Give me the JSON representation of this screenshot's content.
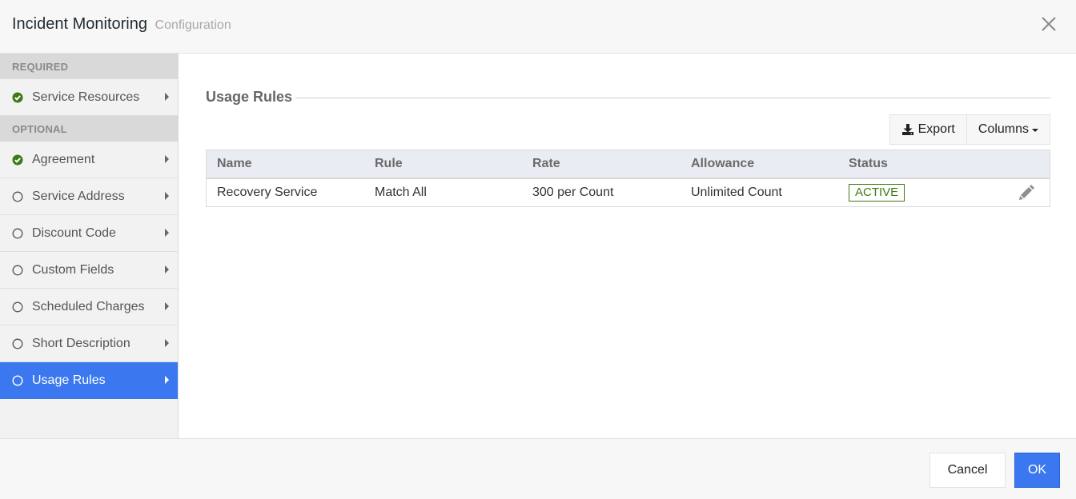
{
  "header": {
    "title": "Incident Monitoring",
    "subtitle": "Configuration",
    "close_icon": "close-icon"
  },
  "sidebar": {
    "sections": [
      {
        "label": "REQUIRED",
        "items": [
          {
            "label": "Service Resources",
            "status": "complete",
            "active": false
          }
        ]
      },
      {
        "label": "OPTIONAL",
        "items": [
          {
            "label": "Agreement",
            "status": "complete",
            "active": false
          },
          {
            "label": "Service Address",
            "status": "incomplete",
            "active": false
          },
          {
            "label": "Discount Code",
            "status": "incomplete",
            "active": false
          },
          {
            "label": "Custom Fields",
            "status": "incomplete",
            "active": false
          },
          {
            "label": "Scheduled Charges",
            "status": "incomplete",
            "active": false
          },
          {
            "label": "Short Description",
            "status": "incomplete",
            "active": false
          },
          {
            "label": "Usage Rules",
            "status": "incomplete",
            "active": true
          }
        ]
      }
    ]
  },
  "main": {
    "section_title": "Usage Rules",
    "toolbar": {
      "export_label": "Export",
      "columns_label": "Columns"
    },
    "table": {
      "columns": [
        "Name",
        "Rule",
        "Rate",
        "Allowance",
        "Status"
      ],
      "rows": [
        {
          "name": "Recovery Service",
          "rule": "Match All",
          "rate": "300 per Count",
          "allowance": "Unlimited Count",
          "status": "ACTIVE"
        }
      ]
    }
  },
  "footer": {
    "cancel_label": "Cancel",
    "ok_label": "OK"
  },
  "colors": {
    "accent": "#3b78f0",
    "success": "#3f7a16"
  }
}
